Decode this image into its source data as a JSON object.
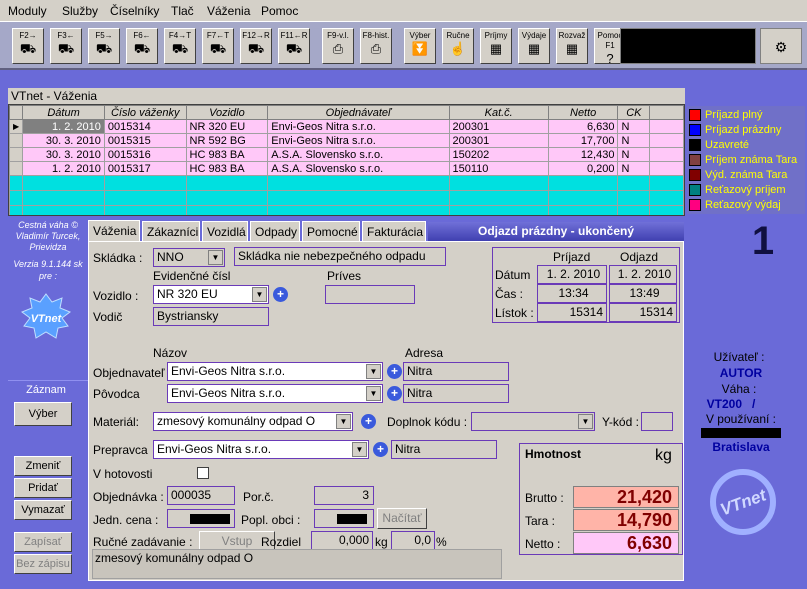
{
  "menu": [
    "Moduly",
    "Služby",
    "Číselníky",
    "Tlač",
    "Váženia",
    "Pomoc"
  ],
  "toolbar": [
    {
      "label": "F2→",
      "icon": "truck-right-icon"
    },
    {
      "label": "F3←",
      "icon": "truck-left-icon"
    },
    {
      "label": "F5→",
      "icon": "truck-right-icon"
    },
    {
      "label": "F6←",
      "icon": "truck-left-icon"
    },
    {
      "label": "F4→T",
      "icon": "truck-right-icon"
    },
    {
      "label": "F7←T",
      "icon": "truck-left-icon"
    },
    {
      "label": "F12→R",
      "icon": "truck-right-icon"
    },
    {
      "label": "F11←R",
      "icon": "truck-left-icon"
    },
    {
      "label": "F9-v.l.",
      "icon": "printer-icon"
    },
    {
      "label": "F8-hist.",
      "icon": "printer-icon"
    },
    {
      "label": "Výber",
      "icon": "funnel-icon"
    },
    {
      "label": "Ručne",
      "icon": "hand-icon"
    },
    {
      "label": "Príjmy",
      "icon": "table-icon"
    },
    {
      "label": "Výdaje",
      "icon": "table-icon"
    },
    {
      "label": "Rozvaž",
      "icon": "table-icon"
    },
    {
      "label": "Pomoc F1",
      "icon": "help-icon"
    }
  ],
  "window_title": "VTnet - Váženia",
  "grid": {
    "columns": [
      "Dátum",
      "Číslo váženky",
      "Vozidlo",
      "Objednávateľ",
      "Kat.č.",
      "Netto",
      "CK"
    ],
    "rows": [
      [
        "1. 2. 2010",
        "0015314",
        "NR 320 EU",
        "Envi-Geos Nitra s.r.o.",
        "200301",
        "6,630",
        "N"
      ],
      [
        "30. 3. 2010",
        "0015315",
        "NR 592 BG",
        "Envi-Geos Nitra s.r.o.",
        "200301",
        "17,700",
        "N"
      ],
      [
        "30. 3. 2010",
        "0015316",
        "HC 983 BA",
        "A.S.A. Slovensko s.r.o.",
        "150202",
        "12,430",
        "N"
      ],
      [
        "1. 2. 2010",
        "0015317",
        "HC 983 BA",
        "A.S.A. Slovensko s.r.o.",
        "150110",
        "0,200",
        "N"
      ]
    ]
  },
  "legend": [
    {
      "label": "Príjazd plný",
      "color": "#ff0000"
    },
    {
      "label": "Príjazd prázdny",
      "color": "#0000ff"
    },
    {
      "label": "Uzavreté",
      "color": "#000000"
    },
    {
      "label": "Príjem známa Tara",
      "color": "#804040"
    },
    {
      "label": "Výd. známa Tara",
      "color": "#800000"
    },
    {
      "label": "Reťazový príjem",
      "color": "#008080"
    },
    {
      "label": "Reťazový výdaj",
      "color": "#ff0080"
    }
  ],
  "left": {
    "info": "Cestná váha © Vladimír Turcek, Prievidza",
    "version": "Verzia 9.1.144 sk pre :",
    "zaznam": "Záznam",
    "buttons": [
      "Výber",
      "Zmeniť",
      "Pridať",
      "Vymazať",
      "Zapísať",
      "Bez zápisu"
    ]
  },
  "tabs": [
    "Váženia",
    "Zákazníci",
    "Vozidlá",
    "Odpady",
    "Pomocné",
    "Fakturácia"
  ],
  "status_title": "Odjazd prázdny - ukončený",
  "form": {
    "skladka_label": "Skládka :",
    "skladka": "NNO",
    "skladka_name": "Skládka nie nebezpečného odpadu",
    "evid_label": "Evidenčné čísl",
    "prives_label": "Príves",
    "vozidlo_label": "Vozidlo :",
    "vozidlo": "NR 320 EU",
    "vodic_label": "Vodič",
    "vodic": "Bystriansky",
    "nazov_label": "Názov",
    "adresa_label": "Adresa",
    "objednavatel_label": "Objednavateľ",
    "objednavatel": "Envi-Geos Nitra s.r.o.",
    "objednavatel_adresa": "Nitra",
    "povodca_label": "Pôvodca",
    "povodca": "Envi-Geos Nitra s.r.o.",
    "povodca_adresa": "Nitra",
    "material_label": "Materiál:",
    "material": "zmesový komunálny odpad O",
    "doplnok_label": "Doplnok kódu :",
    "ykod_label": "Y-kód :",
    "prepravca_label": "Prepravca",
    "prepravca": "Envi-Geos Nitra s.r.o.",
    "prepravca_adresa": "Nitra",
    "hotovost_label": "V hotovosti",
    "objednavka_label": "Objednávka :",
    "objednavka": "000035",
    "porc_label": "Por.č.",
    "porc": "3",
    "jedn_label": "Jedn. cena :",
    "popl_label": "Popl. obci :",
    "nacitat": "Načítať",
    "rucne_label": "Ručné zadávanie :",
    "vstup": "Vstup",
    "rozdiel_label": "Rozdiel",
    "rozdiel": "0,000",
    "kg": "kg",
    "pct": "0,0",
    "pct_sign": "%",
    "note": "zmesový komunálny odpad O"
  },
  "times": {
    "prijazd": "Príjazd",
    "odjazd": "Odjazd",
    "datum_label": "Dátum",
    "cas_label": "Čas :",
    "listok_label": "Lístok :",
    "d1": "1. 2. 2010",
    "d2": "1. 2. 2010",
    "t1": "13:34",
    "t2": "13:49",
    "l1": "15314",
    "l2": "15314"
  },
  "weight": {
    "title": "Hmotnost",
    "unit": "kg",
    "brutto_label": "Brutto :",
    "tara_label": "Tara :",
    "netto_label": "Netto :",
    "brutto": "21,420",
    "tara": "14,790",
    "netto": "6,630"
  },
  "right": {
    "user_label": "Užívateľ :",
    "user": "AUTOR",
    "vaha_label": "Váha :",
    "vaha": "VT200   /",
    "pouzivani_label": "V používaní :",
    "city": "Bratislava"
  }
}
